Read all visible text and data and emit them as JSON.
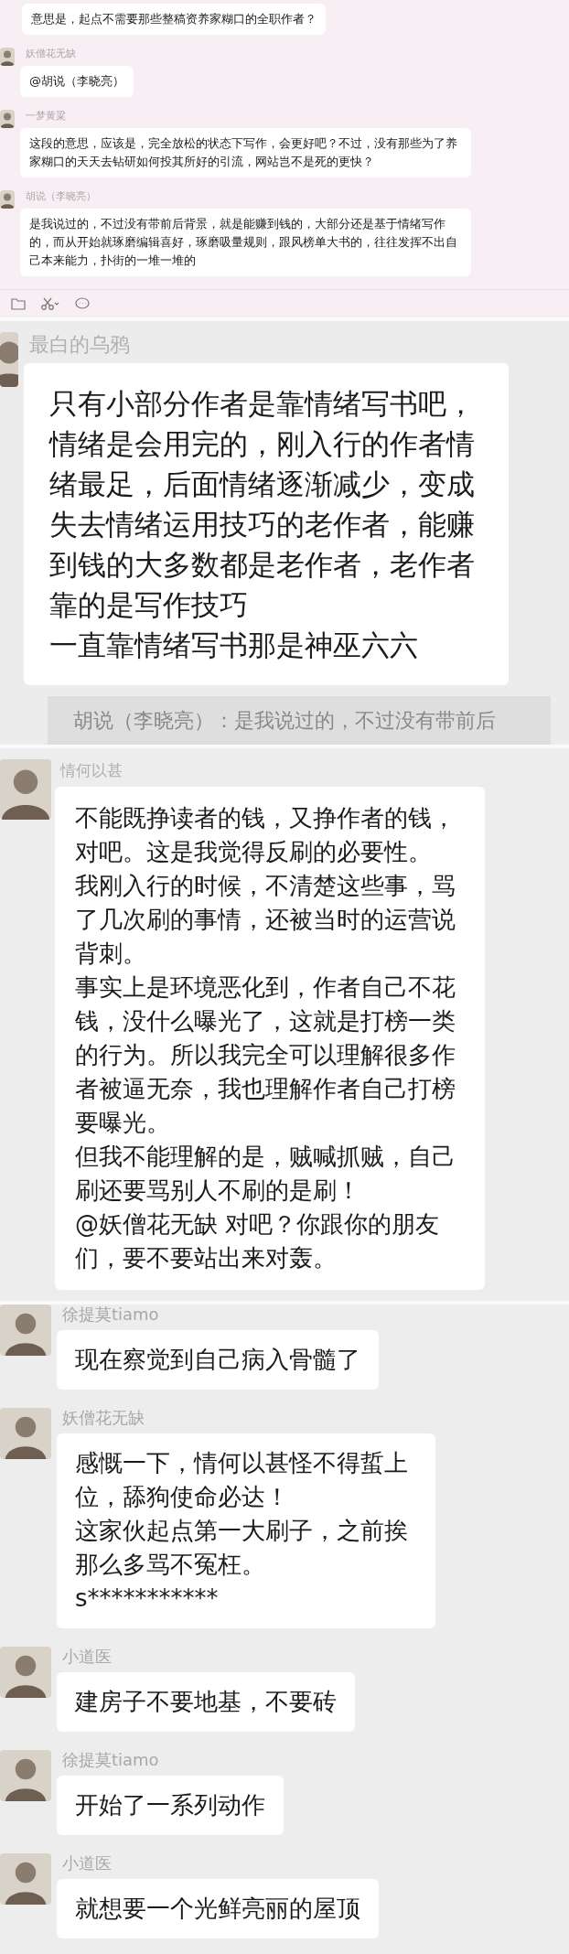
{
  "panels": [
    {
      "kind": "desktop",
      "messages": [
        {
          "paragraphs": [
            "意思是，起点不需要那些整稿资养家糊口的全职作者？"
          ]
        },
        {
          "sender": "妖僧花无缺",
          "paragraphs": [
            "@胡说（李晓亮）"
          ]
        },
        {
          "sender": "一梦黄粱",
          "paragraphs": [
            "这段的意思，应该是，完全放松的状态下写作，会更好吧？不过，没有那些为了养家糊口的天天去钻研如何投其所好的引流，网站岂不是死的更快？"
          ]
        },
        {
          "sender": "胡说（李晓亮）",
          "paragraphs": [
            "是我说过的，不过没有带前后背景，就是能赚到钱的，大部分还是基于情绪写作的，而从开始就琢磨编辑喜好，琢磨吸量规则，跟风榜单大书的，往往发挥不出自己本来能力，扑街的一堆一堆的"
          ]
        }
      ]
    },
    {
      "kind": "large",
      "quote": "胡说（李晓亮）：是我说过的，不过没有带前后",
      "messages": [
        {
          "sender": "最白的乌鸦",
          "paragraphs": [
            "只有小部分作者是靠情绪写书吧，情绪是会用完的，刚入行的作者情绪最足，后面情绪逐渐减少，变成失去情绪运用技巧的老作者，能赚到钱的大多数都是老作者，老作者靠的是写作技巧",
            "一直靠情绪写书那是神巫六六"
          ]
        }
      ]
    },
    {
      "kind": "medium",
      "messages": [
        {
          "sender": "情何以甚",
          "paragraphs": [
            "不能既挣读者的钱，又挣作者的钱，对吧。这是我觉得反刷的必要性。",
            "我刚入行的时候，不清楚这些事，骂了几次刷的事情，还被当时的运营说背刺。",
            "事实上是环境恶化到，作者自己不花钱，没什么曝光了，这就是打榜一类的行为。所以我完全可以理解很多作者被逼无奈，我也理解作者自己打榜要曝光。",
            "但我不能理解的是，贼喊抓贼，自己刷还要骂别人不刷的是刷！",
            "@妖僧花无缺 对吧？你跟你的朋友们，要不要站出来对轰。"
          ]
        }
      ]
    },
    {
      "kind": "phone",
      "messages": [
        {
          "sender": "徐提莫tiamo",
          "paragraphs": [
            "现在察觉到自己病入骨髓了"
          ]
        },
        {
          "sender": "妖僧花无缺",
          "paragraphs": [
            "感慨一下，情何以甚怪不得蜇上位，舔狗使命必达！",
            "这家伙起点第一大刷子，之前挨那么多骂不冤枉。",
            "s***********"
          ]
        },
        {
          "sender": "小道医",
          "paragraphs": [
            "建房子不要地基，不要砖"
          ]
        },
        {
          "sender": "徐提莫tiamo",
          "paragraphs": [
            "开始了一系列动作"
          ]
        },
        {
          "sender": "小道医",
          "paragraphs": [
            "就想要一个光鲜亮丽的屋顶"
          ]
        }
      ]
    }
  ]
}
